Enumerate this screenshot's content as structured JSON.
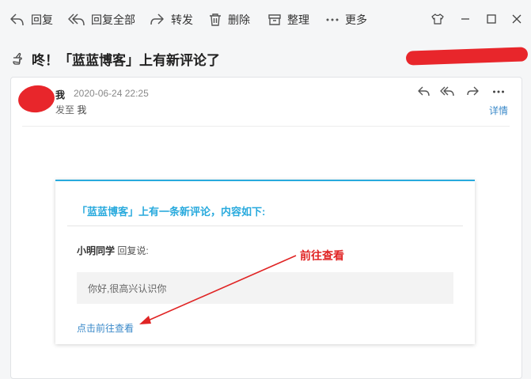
{
  "toolbar": {
    "reply": "回复",
    "reply_all": "回复全部",
    "forward": "转发",
    "delete": "删除",
    "organize": "整理",
    "more": "更多"
  },
  "subject": "咚！「蓝蓝博客」上有新评论了",
  "header": {
    "sender": "我",
    "time": "2020-06-24 22:25",
    "to_label": "发至",
    "to_value": "我",
    "details": "详情"
  },
  "notice": {
    "title": "「蓝蓝博客」上有一条新评论，内容如下:",
    "commenter": "小明同学",
    "reply_said": "回复说:",
    "quote": "你好,很高兴认识你",
    "link": "点击前往查看"
  },
  "annotation": {
    "text": "前往查看",
    "color": "#e02424"
  },
  "colors": {
    "accent": "#29aadd",
    "link": "#3a89c9",
    "redaction": "#e8262b"
  }
}
